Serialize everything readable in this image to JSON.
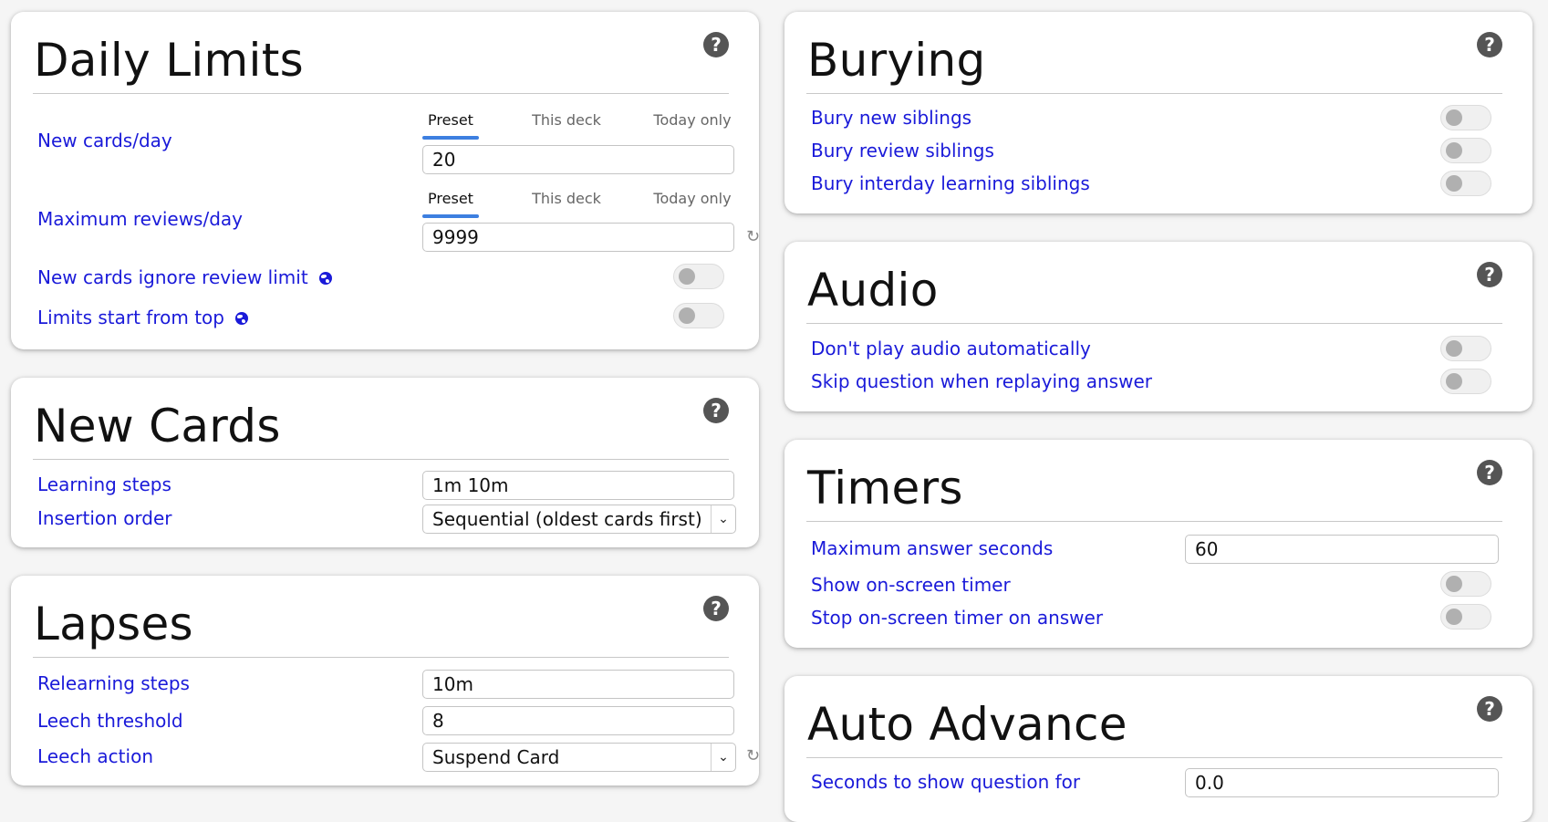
{
  "daily_limits": {
    "title": "Daily Limits",
    "new_cards_label": "New cards/day",
    "max_reviews_label": "Maximum reviews/day",
    "tabs": [
      "Preset",
      "This deck",
      "Today only"
    ],
    "new_cards_value": "20",
    "max_reviews_value": "9999",
    "new_ignore_label": "New cards ignore review limit",
    "limits_top_label": "Limits start from top"
  },
  "new_cards": {
    "title": "New Cards",
    "learning_steps_label": "Learning steps",
    "learning_steps_value": "1m 10m",
    "insertion_order_label": "Insertion order",
    "insertion_order_value": "Sequential (oldest cards first)"
  },
  "lapses": {
    "title": "Lapses",
    "relearning_label": "Relearning steps",
    "relearning_value": "10m",
    "leech_threshold_label": "Leech threshold",
    "leech_threshold_value": "8",
    "leech_action_label": "Leech action",
    "leech_action_value": "Suspend Card"
  },
  "burying": {
    "title": "Burying",
    "bury_new": "Bury new siblings",
    "bury_review": "Bury review siblings",
    "bury_interday": "Bury interday learning siblings"
  },
  "audio": {
    "title": "Audio",
    "dont_play": "Don't play audio automatically",
    "skip_question": "Skip question when replaying answer"
  },
  "timers": {
    "title": "Timers",
    "max_answer_label": "Maximum answer seconds",
    "max_answer_value": "60",
    "show_timer": "Show on-screen timer",
    "stop_timer": "Stop on-screen timer on answer"
  },
  "auto_advance": {
    "title": "Auto Advance",
    "seconds_question_label": "Seconds to show question for",
    "seconds_question_value": "0.0"
  },
  "icons": {
    "help": "?",
    "reset": "↻",
    "chevron": "⌄"
  },
  "colors": {
    "label": "#1a1ad9",
    "tab_underline": "#3d7fe0"
  }
}
